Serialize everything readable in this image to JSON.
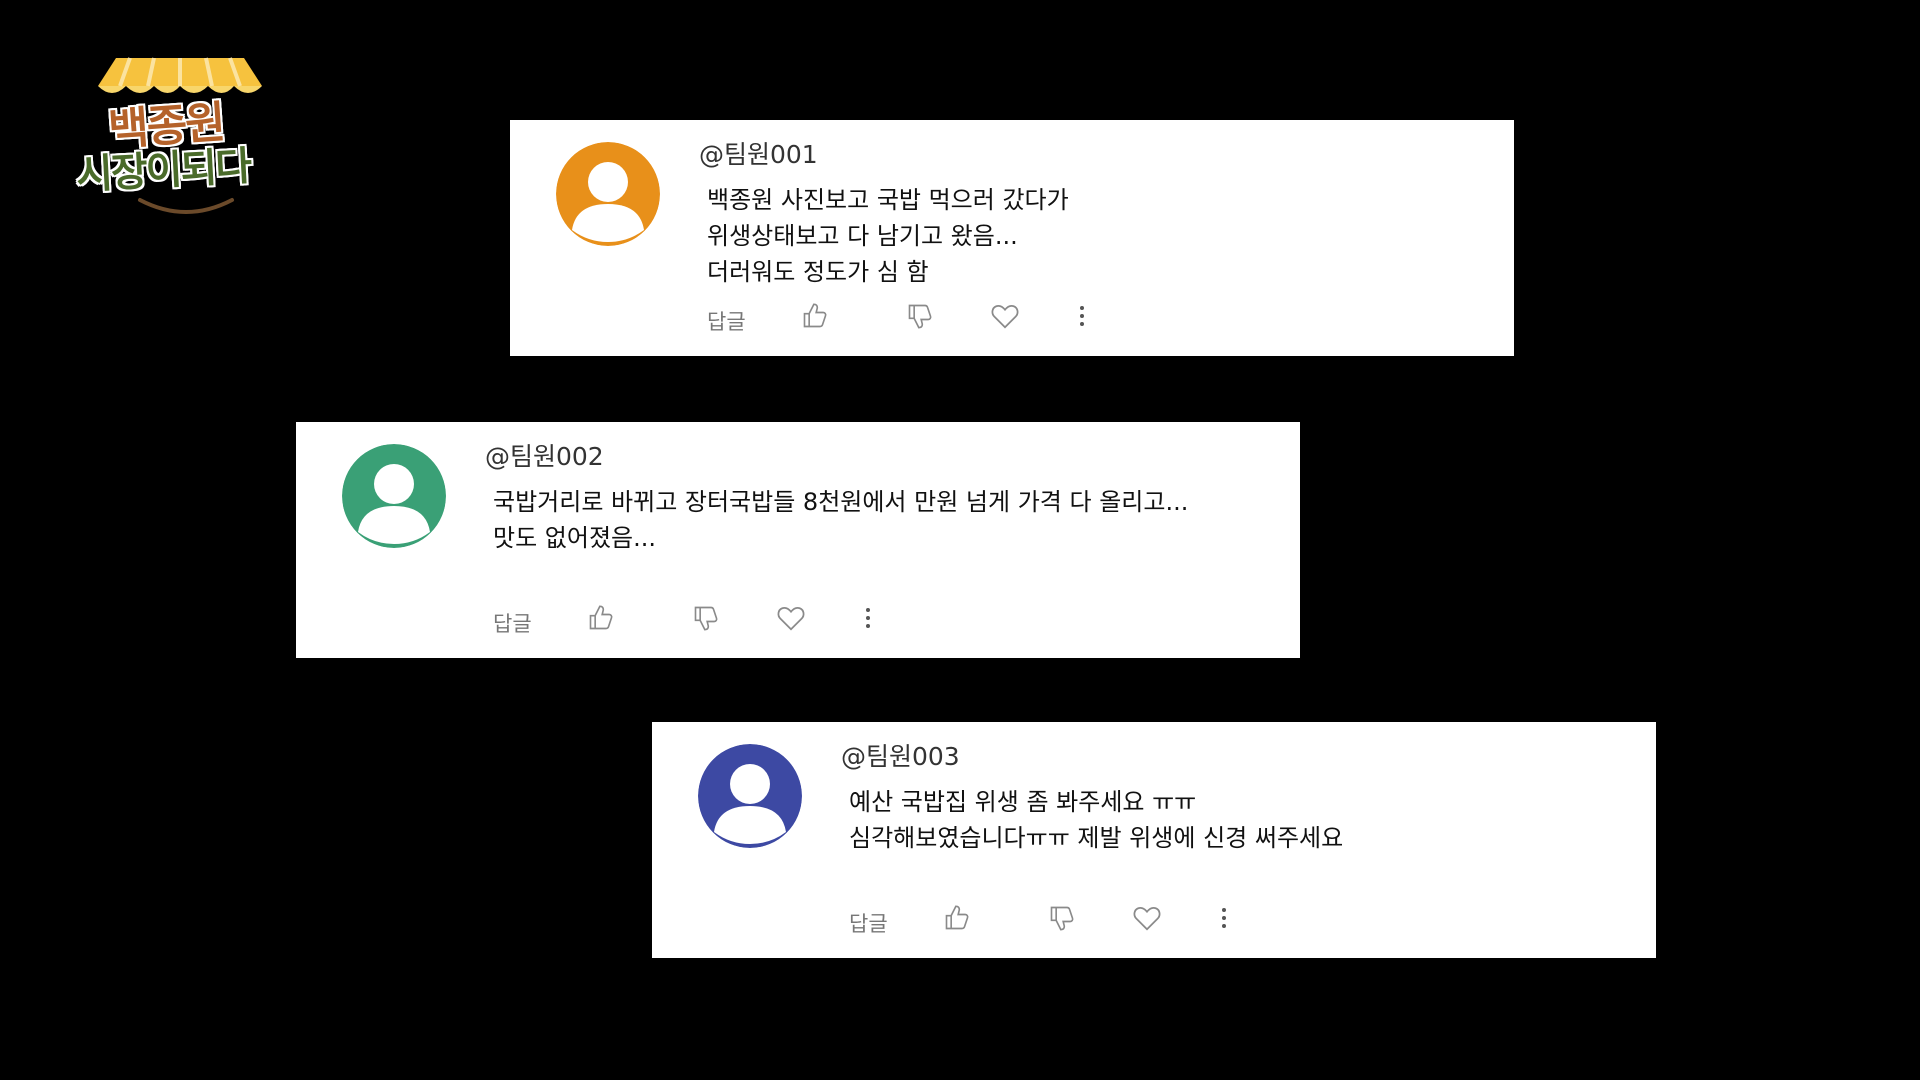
{
  "logo": {
    "line1": "백종원",
    "line2": "시장이되다"
  },
  "colors": {
    "background": "#000000",
    "card": "#ffffff",
    "action_gray": "#8a8a8a"
  },
  "comments": [
    {
      "handle": "@팀원001",
      "avatar_color": "#e8901a",
      "lines": [
        "백종원 사진보고 국밥 먹으러 갔다가",
        "위생상태보고 다 남기고 왔음...",
        "더러워도 정도가 심 함"
      ],
      "reply_label": "답글",
      "icons": [
        "thumbs-up-icon",
        "thumbs-down-icon",
        "heart-icon",
        "more-vertical-icon"
      ]
    },
    {
      "handle": "@팀원002",
      "avatar_color": "#3aa076",
      "lines": [
        "국밥거리로 바뀌고 장터국밥들 8천원에서 만원 넘게 가격 다 올리고...",
        "맛도 없어졌음..."
      ],
      "reply_label": "답글",
      "icons": [
        "thumbs-up-icon",
        "thumbs-down-icon",
        "heart-icon",
        "more-vertical-icon"
      ]
    },
    {
      "handle": "@팀원003",
      "avatar_color": "#3d49a3",
      "lines": [
        "예산 국밥집 위생 좀 봐주세요 ㅠㅠ",
        "심각해보였습니다ㅠㅠ 제발 위생에 신경 써주세요"
      ],
      "reply_label": "답글",
      "icons": [
        "thumbs-up-icon",
        "thumbs-down-icon",
        "heart-icon",
        "more-vertical-icon"
      ]
    }
  ]
}
